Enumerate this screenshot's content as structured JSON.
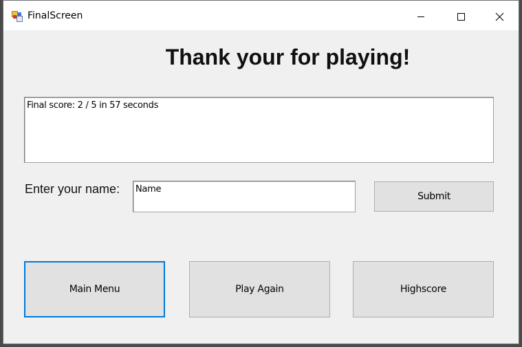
{
  "window": {
    "title": "FinalScreen",
    "icon": "winforms-app-icon",
    "controls": [
      "minimize-icon",
      "maximize-icon",
      "close-icon"
    ]
  },
  "main": {
    "heading": "Thank your for playing!",
    "score_text": "Final score: 2 / 5 in 57 seconds",
    "name_label": "Enter your name:",
    "name_value": "Name",
    "submit_label": "Submit",
    "buttons": {
      "main_menu": "Main Menu",
      "play_again": "Play Again",
      "highscore": "Highscore"
    }
  },
  "colors": {
    "window_bg": "#f0f0f0",
    "focus_border": "#0078d7",
    "button_bg": "#e1e1e1"
  }
}
